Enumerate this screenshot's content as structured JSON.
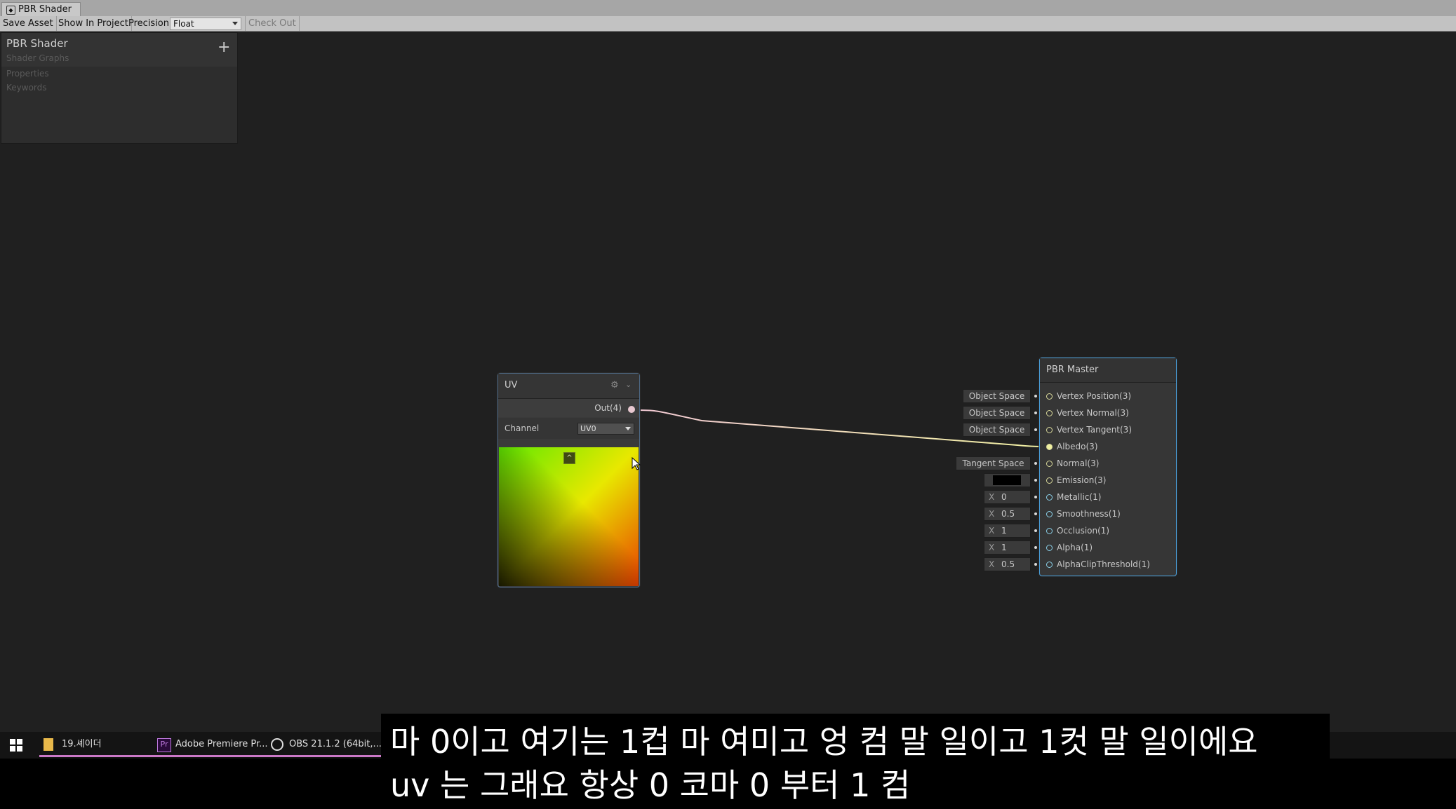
{
  "window": {
    "tab_title": "PBR Shader",
    "tab_icon": "shader-graph-icon"
  },
  "toolbar": {
    "save_asset": "Save Asset",
    "show_in_project": "Show In Project",
    "precision_label": "Precision",
    "precision_value": "Float",
    "check_out": "Check Out"
  },
  "blackboard": {
    "title": "PBR Shader",
    "subtitle": "Shader Graphs",
    "add": "+",
    "properties": "Properties",
    "keywords": "Keywords"
  },
  "uv_node": {
    "title": "UV",
    "output": "Out(4)",
    "channel_label": "Channel",
    "channel_value": "UV0",
    "preview_toggle": "^"
  },
  "master_node": {
    "title": "PBR Master",
    "slots": [
      "Vertex Position(3)",
      "Vertex Normal(3)",
      "Vertex Tangent(3)",
      "Albedo(3)",
      "Normal(3)",
      "Emission(3)",
      "Metallic(1)",
      "Smoothness(1)",
      "Occlusion(1)",
      "Alpha(1)",
      "AlphaClipThreshold(1)"
    ],
    "controls": {
      "vertex_position": "Object Space",
      "vertex_normal": "Object Space",
      "vertex_tangent": "Object Space",
      "normal": "Tangent Space",
      "x": "X",
      "metallic": "0",
      "smoothness": "0.5",
      "occlusion": "1",
      "alpha": "1",
      "alpha_clip": "0.5"
    }
  },
  "taskbar": {
    "items": [
      {
        "label": "19.셰이더",
        "icon": "folder-icon"
      },
      {
        "label": "Adobe Premiere Pr...",
        "icon": "premiere-icon"
      },
      {
        "label": "OBS 21.1.2 (64bit,...",
        "icon": "obs-icon"
      }
    ]
  },
  "subtitles": {
    "line1": "마 0이고 여기는 1컵 마 여미고 엉 컴 말 일이고 1컷 말 일이에요",
    "line2": "uv 는 그래요 항상 0 코마 0 부터 1 컴"
  },
  "colors": {
    "canvas": "#202020",
    "selected_border": "#4aa0dc",
    "edge": "#f0f0a0"
  }
}
